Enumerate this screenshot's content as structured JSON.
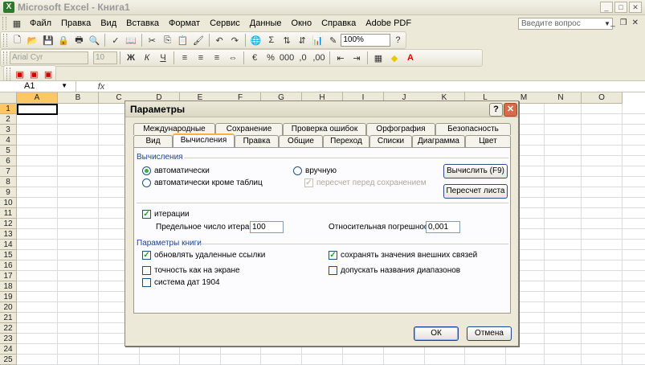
{
  "title": "Microsoft Excel - Книга1",
  "window_buttons": [
    "_",
    "□",
    "✕"
  ],
  "menu": [
    "Файл",
    "Правка",
    "Вид",
    "Вставка",
    "Формат",
    "Сервис",
    "Данные",
    "Окно",
    "Справка",
    "Adobe PDF"
  ],
  "help_placeholder": "Введите вопрос",
  "toolbar": {
    "zoom": "100%",
    "font": "Arial Cyr",
    "size": "10"
  },
  "namebox": "A1",
  "fx": "fx",
  "columns": [
    "A",
    "B",
    "C",
    "D",
    "E",
    "F",
    "G",
    "H",
    "I",
    "J",
    "K",
    "L",
    "M",
    "N",
    "O"
  ],
  "rows": [
    "1",
    "2",
    "3",
    "4",
    "5",
    "6",
    "7",
    "8",
    "9",
    "10",
    "11",
    "12",
    "13",
    "14",
    "15",
    "16",
    "17",
    "18",
    "19",
    "20",
    "21",
    "22",
    "23",
    "24",
    "25"
  ],
  "dialog": {
    "title": "Параметры",
    "help": "?",
    "close": "✕",
    "tabs_top": [
      "Международные",
      "Сохранение",
      "Проверка ошибок",
      "Орфография",
      "Безопасность"
    ],
    "tabs_bottom": [
      "Вид",
      "Вычисления",
      "Правка",
      "Общие",
      "Переход",
      "Списки",
      "Диаграмма",
      "Цвет"
    ],
    "active_tab": "Вычисления",
    "calc_group": "Вычисления",
    "radio_auto": "автоматически",
    "radio_auto_except": "автоматически кроме таблиц",
    "radio_manual": "вручную",
    "recalc_before_save": "пересчет перед сохранением",
    "btn_calc_now": "Вычислить (F9)",
    "btn_calc_sheet": "Пересчет листа",
    "iterations": "итерации",
    "max_iter_label": "Предельное число итераций:",
    "max_iter_value": "100",
    "rel_err_label": "Относительная погрешность:",
    "rel_err_value": "0,001",
    "book_group": "Параметры книги",
    "update_links": "обновлять удаленные ссылки",
    "precision_display": "точность как на экране",
    "date_1904": "система дат 1904",
    "save_ext_links": "сохранять значения внешних связей",
    "accept_labels": "допускать названия диапазонов",
    "ok": "ОК",
    "cancel": "Отмена"
  }
}
